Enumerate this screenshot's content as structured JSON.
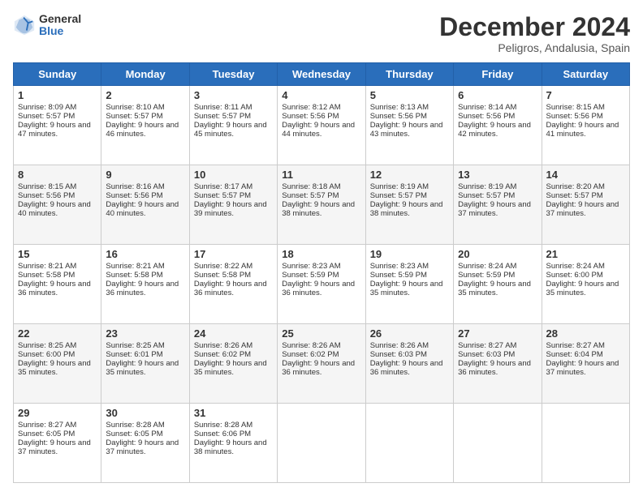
{
  "header": {
    "logo": {
      "general": "General",
      "blue": "Blue"
    },
    "title": "December 2024",
    "location": "Peligros, Andalusia, Spain"
  },
  "calendar": {
    "days_of_week": [
      "Sunday",
      "Monday",
      "Tuesday",
      "Wednesday",
      "Thursday",
      "Friday",
      "Saturday"
    ],
    "weeks": [
      [
        null,
        null,
        null,
        null,
        null,
        null,
        null
      ]
    ],
    "cells": [
      {
        "day": "1",
        "sunrise": "Sunrise: 8:09 AM",
        "sunset": "Sunset: 5:57 PM",
        "daylight": "Daylight: 9 hours and 47 minutes."
      },
      {
        "day": "2",
        "sunrise": "Sunrise: 8:10 AM",
        "sunset": "Sunset: 5:57 PM",
        "daylight": "Daylight: 9 hours and 46 minutes."
      },
      {
        "day": "3",
        "sunrise": "Sunrise: 8:11 AM",
        "sunset": "Sunset: 5:57 PM",
        "daylight": "Daylight: 9 hours and 45 minutes."
      },
      {
        "day": "4",
        "sunrise": "Sunrise: 8:12 AM",
        "sunset": "Sunset: 5:56 PM",
        "daylight": "Daylight: 9 hours and 44 minutes."
      },
      {
        "day": "5",
        "sunrise": "Sunrise: 8:13 AM",
        "sunset": "Sunset: 5:56 PM",
        "daylight": "Daylight: 9 hours and 43 minutes."
      },
      {
        "day": "6",
        "sunrise": "Sunrise: 8:14 AM",
        "sunset": "Sunset: 5:56 PM",
        "daylight": "Daylight: 9 hours and 42 minutes."
      },
      {
        "day": "7",
        "sunrise": "Sunrise: 8:15 AM",
        "sunset": "Sunset: 5:56 PM",
        "daylight": "Daylight: 9 hours and 41 minutes."
      },
      {
        "day": "8",
        "sunrise": "Sunrise: 8:15 AM",
        "sunset": "Sunset: 5:56 PM",
        "daylight": "Daylight: 9 hours and 40 minutes."
      },
      {
        "day": "9",
        "sunrise": "Sunrise: 8:16 AM",
        "sunset": "Sunset: 5:56 PM",
        "daylight": "Daylight: 9 hours and 40 minutes."
      },
      {
        "day": "10",
        "sunrise": "Sunrise: 8:17 AM",
        "sunset": "Sunset: 5:57 PM",
        "daylight": "Daylight: 9 hours and 39 minutes."
      },
      {
        "day": "11",
        "sunrise": "Sunrise: 8:18 AM",
        "sunset": "Sunset: 5:57 PM",
        "daylight": "Daylight: 9 hours and 38 minutes."
      },
      {
        "day": "12",
        "sunrise": "Sunrise: 8:19 AM",
        "sunset": "Sunset: 5:57 PM",
        "daylight": "Daylight: 9 hours and 38 minutes."
      },
      {
        "day": "13",
        "sunrise": "Sunrise: 8:19 AM",
        "sunset": "Sunset: 5:57 PM",
        "daylight": "Daylight: 9 hours and 37 minutes."
      },
      {
        "day": "14",
        "sunrise": "Sunrise: 8:20 AM",
        "sunset": "Sunset: 5:57 PM",
        "daylight": "Daylight: 9 hours and 37 minutes."
      },
      {
        "day": "15",
        "sunrise": "Sunrise: 8:21 AM",
        "sunset": "Sunset: 5:58 PM",
        "daylight": "Daylight: 9 hours and 36 minutes."
      },
      {
        "day": "16",
        "sunrise": "Sunrise: 8:21 AM",
        "sunset": "Sunset: 5:58 PM",
        "daylight": "Daylight: 9 hours and 36 minutes."
      },
      {
        "day": "17",
        "sunrise": "Sunrise: 8:22 AM",
        "sunset": "Sunset: 5:58 PM",
        "daylight": "Daylight: 9 hours and 36 minutes."
      },
      {
        "day": "18",
        "sunrise": "Sunrise: 8:23 AM",
        "sunset": "Sunset: 5:59 PM",
        "daylight": "Daylight: 9 hours and 36 minutes."
      },
      {
        "day": "19",
        "sunrise": "Sunrise: 8:23 AM",
        "sunset": "Sunset: 5:59 PM",
        "daylight": "Daylight: 9 hours and 35 minutes."
      },
      {
        "day": "20",
        "sunrise": "Sunrise: 8:24 AM",
        "sunset": "Sunset: 5:59 PM",
        "daylight": "Daylight: 9 hours and 35 minutes."
      },
      {
        "day": "21",
        "sunrise": "Sunrise: 8:24 AM",
        "sunset": "Sunset: 6:00 PM",
        "daylight": "Daylight: 9 hours and 35 minutes."
      },
      {
        "day": "22",
        "sunrise": "Sunrise: 8:25 AM",
        "sunset": "Sunset: 6:00 PM",
        "daylight": "Daylight: 9 hours and 35 minutes."
      },
      {
        "day": "23",
        "sunrise": "Sunrise: 8:25 AM",
        "sunset": "Sunset: 6:01 PM",
        "daylight": "Daylight: 9 hours and 35 minutes."
      },
      {
        "day": "24",
        "sunrise": "Sunrise: 8:26 AM",
        "sunset": "Sunset: 6:02 PM",
        "daylight": "Daylight: 9 hours and 35 minutes."
      },
      {
        "day": "25",
        "sunrise": "Sunrise: 8:26 AM",
        "sunset": "Sunset: 6:02 PM",
        "daylight": "Daylight: 9 hours and 36 minutes."
      },
      {
        "day": "26",
        "sunrise": "Sunrise: 8:26 AM",
        "sunset": "Sunset: 6:03 PM",
        "daylight": "Daylight: 9 hours and 36 minutes."
      },
      {
        "day": "27",
        "sunrise": "Sunrise: 8:27 AM",
        "sunset": "Sunset: 6:03 PM",
        "daylight": "Daylight: 9 hours and 36 minutes."
      },
      {
        "day": "28",
        "sunrise": "Sunrise: 8:27 AM",
        "sunset": "Sunset: 6:04 PM",
        "daylight": "Daylight: 9 hours and 37 minutes."
      },
      {
        "day": "29",
        "sunrise": "Sunrise: 8:27 AM",
        "sunset": "Sunset: 6:05 PM",
        "daylight": "Daylight: 9 hours and 37 minutes."
      },
      {
        "day": "30",
        "sunrise": "Sunrise: 8:28 AM",
        "sunset": "Sunset: 6:05 PM",
        "daylight": "Daylight: 9 hours and 37 minutes."
      },
      {
        "day": "31",
        "sunrise": "Sunrise: 8:28 AM",
        "sunset": "Sunset: 6:06 PM",
        "daylight": "Daylight: 9 hours and 38 minutes."
      }
    ]
  }
}
